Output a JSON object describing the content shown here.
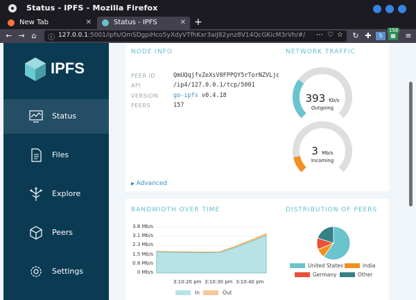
{
  "window": {
    "title": "Status - IPFS - Mozilla Firefox"
  },
  "tabs": [
    {
      "label": "New Tab",
      "active": false
    },
    {
      "label": "Status - IPFS",
      "active": true
    }
  ],
  "address_bar": {
    "host": "127.0.0.1",
    "path": ":5001/ipfs/QmSDgpiHco5yXdyVTfhKxr3aiJ82ynz8V14QcGKicM3rVh/#/"
  },
  "toolbar": {
    "badge_count": "156",
    "more_icon": "⋯",
    "pocket_icon": "♡",
    "bookmark_icon": "☆"
  },
  "logo": {
    "text": "IPFS"
  },
  "sidebar": {
    "items": [
      {
        "label": "Status",
        "icon": "status-icon",
        "active": true
      },
      {
        "label": "Files",
        "icon": "files-icon",
        "active": false
      },
      {
        "label": "Explore",
        "icon": "explore-icon",
        "active": false
      },
      {
        "label": "Peers",
        "icon": "peers-icon",
        "active": false
      },
      {
        "label": "Settings",
        "icon": "settings-icon",
        "active": false
      }
    ]
  },
  "node_info": {
    "title": "NODE INFO",
    "peer_id_label": "PEER ID",
    "peer_id": "QmUQqjfvZeXsV8FPPQY5rTorNZVLjq…",
    "api_label": "API",
    "api": "/ip4/127.0.0.1/tcp/5001",
    "version_label": "VERSION",
    "version": "go-ipfs v0.4.18",
    "peers_label": "PEERS",
    "peers": "157",
    "advanced": "Advanced"
  },
  "network_traffic": {
    "title": "NETWORK TRAFFIC",
    "outgoing": {
      "value": "393",
      "unit": "Kb/s",
      "label": "Outgoing",
      "fraction": 0.3
    },
    "incoming": {
      "value": "3",
      "unit": "Mb/s",
      "label": "Incoming",
      "fraction": 0.12
    }
  },
  "bandwidth": {
    "title": "BANDWIDTH OVER TIME"
  },
  "peers_distribution": {
    "title": "DISTRIBUTION OF PEERS"
  },
  "colors": {
    "teal": "#69c4cd",
    "orange": "#f39021",
    "red": "#ea5037",
    "dark_teal": "#378085",
    "peach": "#f8c79a",
    "light_teal": "#b7e3e6"
  },
  "chart_data": [
    {
      "type": "area",
      "title": "BANDWIDTH OVER TIME",
      "y_ticks": [
        "3.8 Mb/s",
        "3.1 Mb/s",
        "2.3 Mb/s",
        "1.5 Mb/s",
        "0.8 Mb/s",
        "0 Mb/s"
      ],
      "x_ticks": [
        "3:10:20 pm",
        "3:10:30 pm",
        "3:10:40 pm"
      ],
      "ylim": [
        0,
        3.8
      ],
      "x_seconds": [
        0,
        8,
        16,
        24,
        32,
        40,
        48,
        56
      ],
      "series": [
        {
          "name": "In",
          "values": [
            1.75,
            1.72,
            1.7,
            1.68,
            1.7,
            2.1,
            2.6,
            3.1
          ]
        },
        {
          "name": "Out",
          "values": [
            0.05,
            0.05,
            0.05,
            0.05,
            0.05,
            0.1,
            0.12,
            0.15
          ]
        }
      ]
    },
    {
      "type": "pie",
      "title": "DISTRIBUTION OF PEERS",
      "labels": [
        "United States",
        "India",
        "Germany",
        "Other"
      ],
      "values": [
        60,
        9,
        11,
        20
      ]
    }
  ]
}
